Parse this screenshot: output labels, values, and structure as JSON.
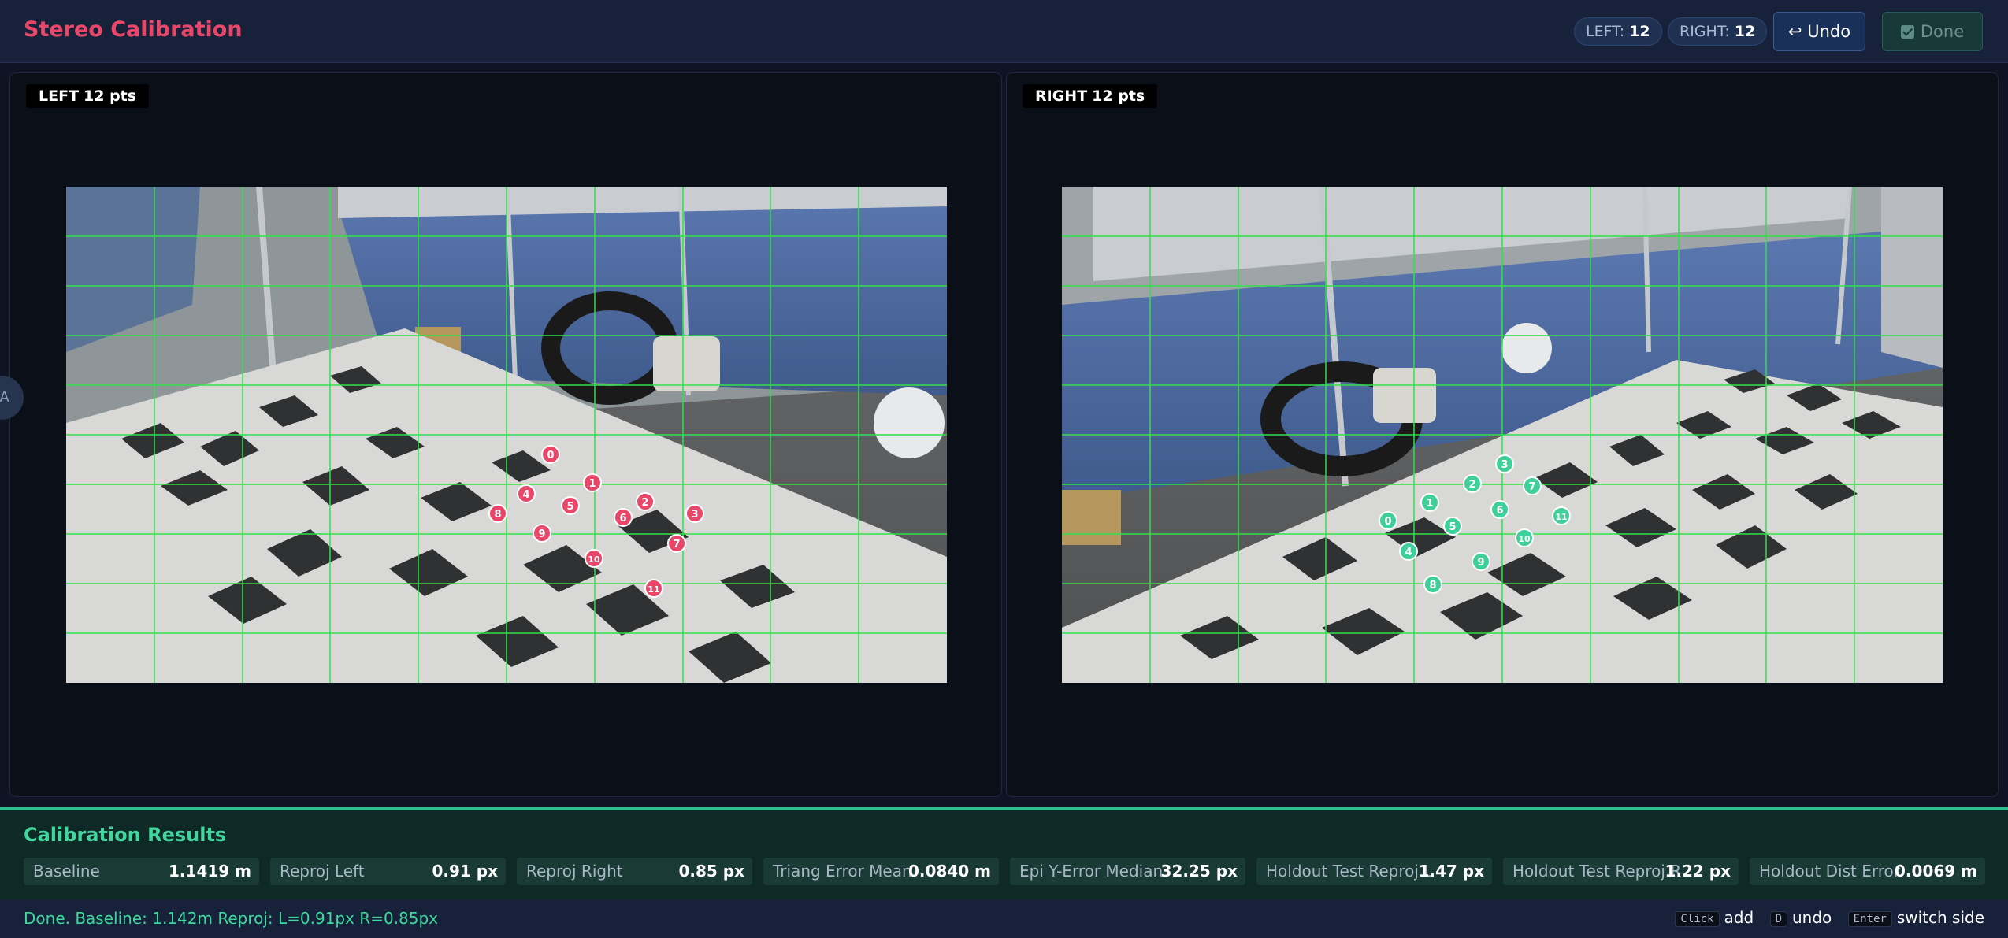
{
  "header": {
    "title": "Stereo Calibration",
    "left_count_label": "LEFT:",
    "left_count": "12",
    "right_count_label": "RIGHT:",
    "right_count": "12",
    "undo_label": "↩ Undo",
    "done_label": "Done"
  },
  "left_panel": {
    "side": "LEFT",
    "points_label": "12 pts",
    "marker_color": "#e8476a",
    "points": [
      {
        "label": "0"
      },
      {
        "label": "1"
      },
      {
        "label": "2"
      },
      {
        "label": "3"
      },
      {
        "label": "4"
      },
      {
        "label": "5"
      },
      {
        "label": "6"
      },
      {
        "label": "7"
      },
      {
        "label": "8"
      },
      {
        "label": "9"
      },
      {
        "label": "10"
      },
      {
        "label": "11"
      }
    ]
  },
  "right_panel": {
    "side": "RIGHT",
    "points_label": "12 pts",
    "marker_color": "#3fcf9a",
    "points": [
      {
        "label": "0"
      },
      {
        "label": "1"
      },
      {
        "label": "2"
      },
      {
        "label": "3"
      },
      {
        "label": "4"
      },
      {
        "label": "5"
      },
      {
        "label": "6"
      },
      {
        "label": "7"
      },
      {
        "label": "8"
      },
      {
        "label": "9"
      },
      {
        "label": "10"
      },
      {
        "label": "11"
      }
    ]
  },
  "side_tab": {
    "icon": "collapse-icon",
    "glyph": "‹A"
  },
  "results": {
    "title": "Calibration Results",
    "metrics": [
      {
        "label": "Baseline",
        "value": "1.1419 m"
      },
      {
        "label": "Reproj Left",
        "value": "0.91 px"
      },
      {
        "label": "Reproj Right",
        "value": "0.85 px"
      },
      {
        "label": "Triang Error Mean",
        "value": "0.0840 m"
      },
      {
        "label": "Epi Y-Error Median",
        "value": "32.25 px"
      },
      {
        "label": "Holdout Test Reproj L",
        "value": "1.47 px"
      },
      {
        "label": "Holdout Test Reproj R",
        "value": "1.22 px"
      },
      {
        "label": "Holdout Dist Error",
        "value": "0.0069 m"
      }
    ]
  },
  "status": {
    "text": "Done. Baseline: 1.142m Reproj: L=0.91px R=0.85px",
    "shortcuts": [
      {
        "key": "Click",
        "action": "add"
      },
      {
        "key": "D",
        "action": "undo"
      },
      {
        "key": "Enter",
        "action": "switch side"
      }
    ]
  },
  "colors": {
    "accent": "#e8476a",
    "success": "#3fd79d",
    "grid": "#33e04a"
  }
}
